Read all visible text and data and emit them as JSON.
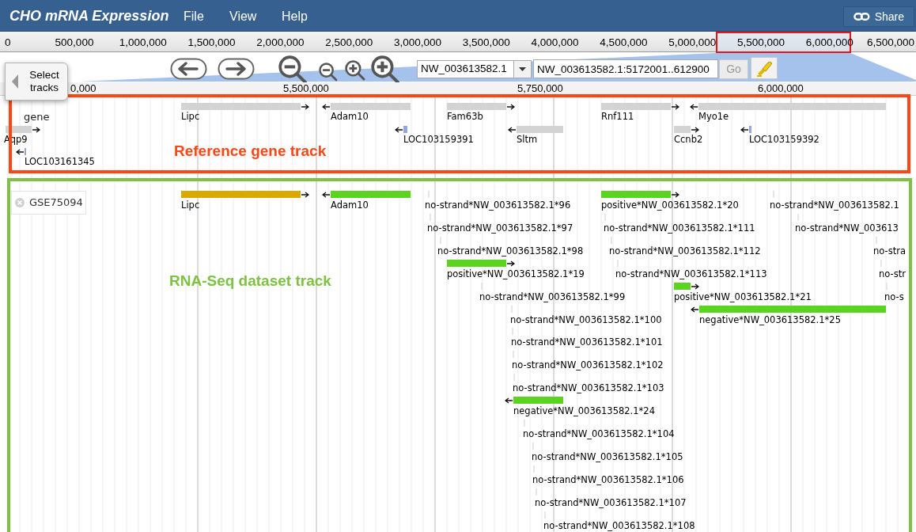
{
  "header": {
    "title": "CHO mRNA Expression",
    "menu": [
      "File",
      "View",
      "Help"
    ],
    "share": "Share"
  },
  "overview_ruler": {
    "labels": [
      "0",
      "500,000",
      "1,000,000",
      "1,500,000",
      "2,000,000",
      "2,500,000",
      "3,000,000",
      "3,500,000",
      "4,000,000",
      "4,500,000",
      "5,000,000",
      "5,500,000",
      "6,000,000",
      "6,500,000"
    ]
  },
  "toolbar": {
    "select_tracks": "Select tracks",
    "reference": "NW_003613582.1",
    "location": "NW_003613582.1:5172001..612900",
    "go": "Go"
  },
  "detail_ruler": {
    "labels": [
      "0,000",
      "5,500,000",
      "5,750,000",
      "6,000,000"
    ]
  },
  "gene_track": {
    "label": "gene",
    "annotation": "Reference gene track",
    "features": [
      {
        "name": "Lipc",
        "kind": "forward",
        "color": "#d3d3d3"
      },
      {
        "name": "Adam10",
        "kind": "reverse",
        "color": "#d3d3d3"
      },
      {
        "name": "Fam63b",
        "kind": "forward",
        "color": "#d3d3d3"
      },
      {
        "name": "Rnf111",
        "kind": "forward",
        "color": "#d3d3d3"
      },
      {
        "name": "Myo1e",
        "kind": "reverse",
        "color": "#d3d3d3"
      },
      {
        "name": "Aqp9",
        "kind": "forward",
        "color": "#d3d3d3"
      },
      {
        "name": "LOC103159391",
        "kind": "reverse",
        "color": "#8fa8e0"
      },
      {
        "name": "Sltm",
        "kind": "reverse",
        "color": "#d3d3d3"
      },
      {
        "name": "Ccnb2",
        "kind": "forward",
        "color": "#d3d3d3"
      },
      {
        "name": "LOC103159392",
        "kind": "reverse",
        "color": "#8fa8e0"
      },
      {
        "name": "LOC103161345",
        "kind": "reverse",
        "color": "#8fa8e0"
      }
    ]
  },
  "rna_track": {
    "label": "GSE75094",
    "annotation": "RNA-Seq dataset track",
    "features": [
      {
        "name": "Lipc",
        "kind": "forward",
        "color": "#daa900"
      },
      {
        "name": "Adam10",
        "kind": "reverse",
        "color": "#5ad41e"
      },
      {
        "name": "no-strand*NW_003613582.1*96",
        "kind": "unstranded",
        "color": "#e6e6e6"
      },
      {
        "name": "positive*NW_003613582.1*20",
        "kind": "forward",
        "color": "#5ad41e"
      },
      {
        "name": "no-strand*NW_003613582.1",
        "kind": "unstranded",
        "color": "#e6e6e6"
      },
      {
        "name": "no-strand*NW_003613582.1*97",
        "kind": "unstranded",
        "color": "#e6e6e6"
      },
      {
        "name": "no-strand*NW_003613582.1*111",
        "kind": "unstranded",
        "color": "#e6e6e6"
      },
      {
        "name": "no-strand*NW_003613",
        "kind": "unstranded",
        "color": "#e6e6e6"
      },
      {
        "name": "no-strand*NW_003613582.1*98",
        "kind": "unstranded",
        "color": "#e6e6e6"
      },
      {
        "name": "no-strand*NW_003613582.1*112",
        "kind": "unstranded",
        "color": "#e6e6e6"
      },
      {
        "name": "no-stra",
        "kind": "unstranded",
        "color": "#e6e6e6"
      },
      {
        "name": "positive*NW_003613582.1*19",
        "kind": "forward",
        "color": "#5ad41e"
      },
      {
        "name": "no-strand*NW_003613582.1*113",
        "kind": "unstranded",
        "color": "#e6e6e6"
      },
      {
        "name": "no-str",
        "kind": "unstranded",
        "color": "#e6e6e6"
      },
      {
        "name": "no-strand*NW_003613582.1*99",
        "kind": "unstranded",
        "color": "#e6e6e6"
      },
      {
        "name": "positive*NW_003613582.1*21",
        "kind": "forward",
        "color": "#5ad41e"
      },
      {
        "name": "no-s",
        "kind": "unstranded",
        "color": "#e6e6e6"
      },
      {
        "name": "no-strand*NW_003613582.1*100",
        "kind": "unstranded",
        "color": "#e6e6e6"
      },
      {
        "name": "negative*NW_003613582.1*25",
        "kind": "reverse",
        "color": "#5ad41e"
      },
      {
        "name": "no-strand*NW_003613582.1*101",
        "kind": "unstranded",
        "color": "#e6e6e6"
      },
      {
        "name": "no-strand*NW_003613582.1*102",
        "kind": "unstranded",
        "color": "#e6e6e6"
      },
      {
        "name": "no-strand*NW_003613582.1*103",
        "kind": "unstranded",
        "color": "#e6e6e6"
      },
      {
        "name": "negative*NW_003613582.1*24",
        "kind": "reverse",
        "color": "#5ad41e"
      },
      {
        "name": "no-strand*NW_003613582.1*104",
        "kind": "unstranded",
        "color": "#e6e6e6"
      },
      {
        "name": "no-strand*NW_003613582.1*105",
        "kind": "unstranded",
        "color": "#e6e6e6"
      },
      {
        "name": "no-strand*NW_003613582.1*106",
        "kind": "unstranded",
        "color": "#e6e6e6"
      },
      {
        "name": "no-strand*NW_003613582.1*107",
        "kind": "unstranded",
        "color": "#e6e6e6"
      },
      {
        "name": "no-strand*NW_003613582.1*108",
        "kind": "unstranded",
        "color": "#e6e6e6"
      }
    ]
  }
}
